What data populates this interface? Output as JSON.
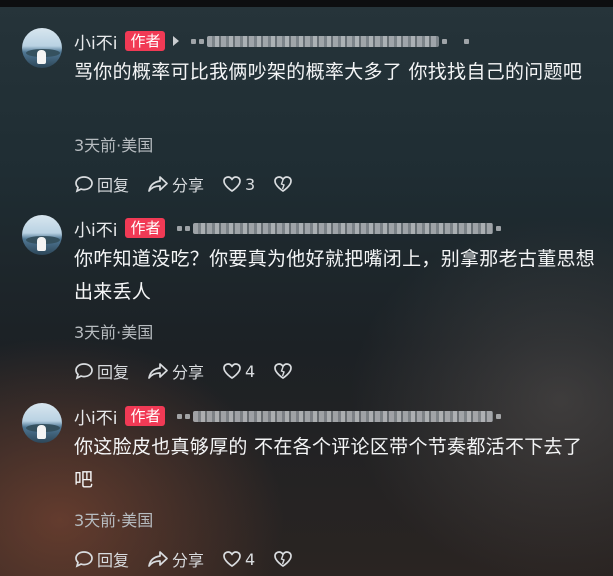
{
  "comments": [
    {
      "username": "小i不i",
      "badge": "作者",
      "text": "骂你的概率可比我俩吵架的概率大多了 你找找自己的问题吧",
      "meta": "3天前·美国",
      "reply_label": "回复",
      "share_label": "分享",
      "like_count": "3"
    },
    {
      "username": "小i不i",
      "badge": "作者",
      "text": "你咋知道没吃？你要真为他好就把嘴闭上，别拿那老古董思想出来丢人",
      "meta": "3天前·美国",
      "reply_label": "回复",
      "share_label": "分享",
      "like_count": "4"
    },
    {
      "username": "小i不i",
      "badge": "作者",
      "text": "你这脸皮也真够厚的 不在各个评论区带个节奏都活不下去了吧",
      "meta": "3天前·美国",
      "reply_label": "回复",
      "share_label": "分享",
      "like_count": "4"
    }
  ],
  "colors": {
    "badge": "#f13a55",
    "text": "#f4f5f6",
    "meta": "#b7bcc0",
    "background_top": "#26343a"
  },
  "icons": [
    "reply-icon",
    "share-icon",
    "heart-icon",
    "dislike-heart-icon",
    "arrow-right-icon"
  ]
}
